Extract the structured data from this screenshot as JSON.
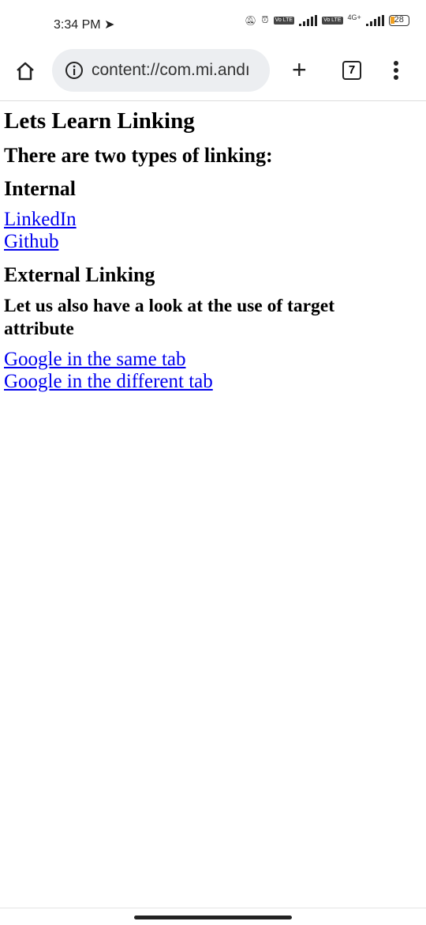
{
  "status_bar": {
    "time": "3:34 PM",
    "network_type": "4G+",
    "battery": "28",
    "volte": "Vo LTE"
  },
  "browser": {
    "url": "content://com.mi.andı",
    "tab_count": "7"
  },
  "page": {
    "title": "Lets Learn Linking",
    "subtitle": "There are two types of linking:",
    "internal_heading": "Internal",
    "internal_links": [
      "LinkedIn",
      "Github"
    ],
    "external_heading": "External Linking",
    "target_heading_line1": "Let us also have a look at the use of target",
    "target_heading_line2": "attribute",
    "target_links": [
      "Google in the same tab",
      "Google in the different tab"
    ]
  },
  "colors": {
    "link": "#0000ee",
    "url_bar": "#eceef1"
  }
}
